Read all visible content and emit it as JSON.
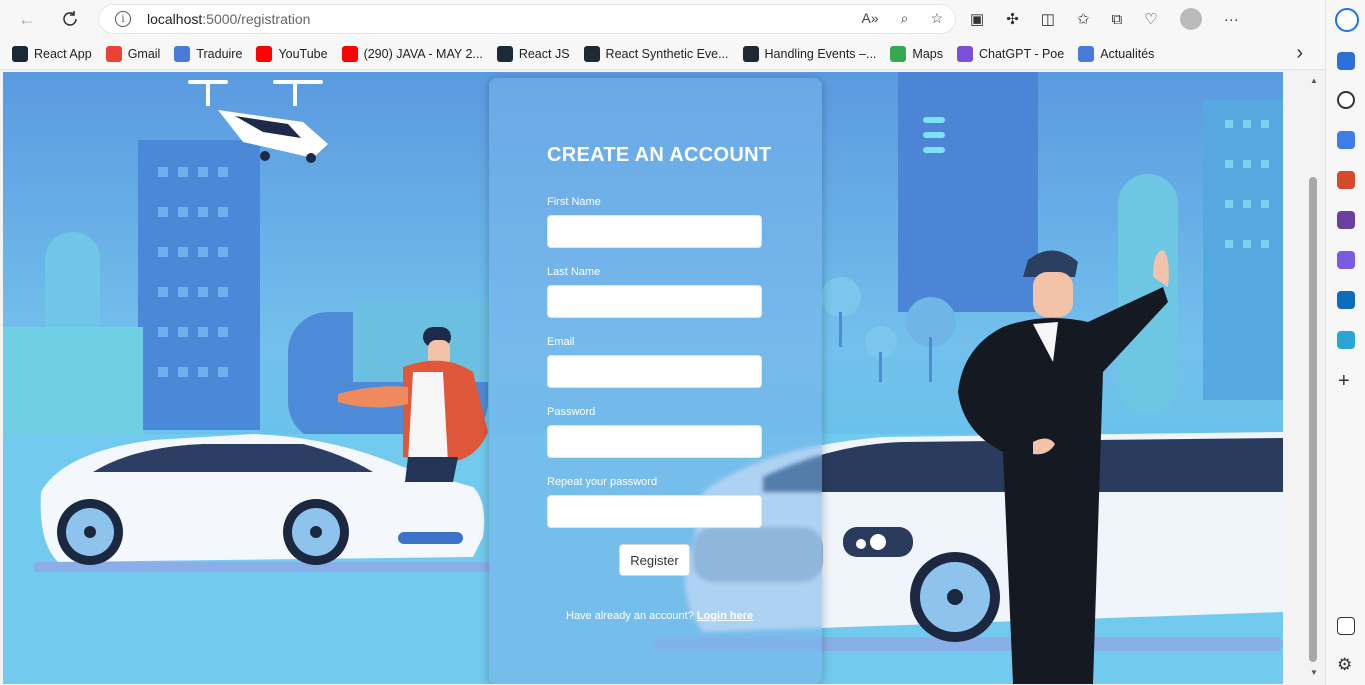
{
  "browser": {
    "url_host": "localhost",
    "url_path": ":5000/registration"
  },
  "bookmarks": [
    {
      "label": "React App",
      "icon": "react-icon",
      "color": "#1b2a36"
    },
    {
      "label": "Gmail",
      "icon": "google-icon",
      "color": "#ea4335"
    },
    {
      "label": "Traduire",
      "icon": "translate-icon",
      "color": "#4a7bd8"
    },
    {
      "label": "YouTube",
      "icon": "youtube-icon",
      "color": "#ff0000"
    },
    {
      "label": "(290) JAVA - MAY 2...",
      "icon": "youtube-icon",
      "color": "#ff0000"
    },
    {
      "label": "React JS",
      "icon": "react-icon",
      "color": "#1b2a36"
    },
    {
      "label": "React Synthetic Eve...",
      "icon": "react-icon",
      "color": "#1b2a36"
    },
    {
      "label": "Handling Events –...",
      "icon": "react-icon",
      "color": "#1b2a36"
    },
    {
      "label": "Maps",
      "icon": "maps-icon",
      "color": "#34a853"
    },
    {
      "label": "ChatGPT - Poe",
      "icon": "poe-icon",
      "color": "#7b4fd6"
    },
    {
      "label": "Actualités",
      "icon": "news-icon",
      "color": "#4a7bd8"
    }
  ],
  "form": {
    "title": "CREATE AN ACCOUNT",
    "first_name_label": "First Name",
    "last_name_label": "Last Name",
    "email_label": "Email",
    "password_label": "Password",
    "repeat_password_label": "Repeat your password",
    "register_label": "Register",
    "login_prompt": "Have already an account?",
    "login_link": "Login here"
  }
}
